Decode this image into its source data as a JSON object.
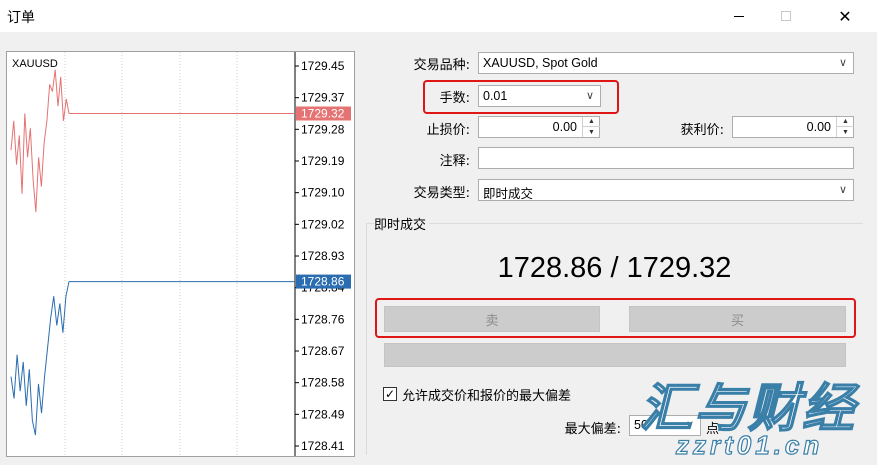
{
  "window": {
    "title": "订单"
  },
  "chart": {
    "symbol": "XAUUSD",
    "price_labels": [
      "1729.45",
      "1729.37",
      "1729.28",
      "1729.19",
      "1729.10",
      "1729.02",
      "1728.93",
      "1728.84",
      "1728.76",
      "1728.67",
      "1728.58",
      "1728.49",
      "1728.41"
    ],
    "ask_label": "1729.32",
    "bid_label": "1728.86",
    "ask_color": "#e57373",
    "bid_color": "#2a6db0",
    "grid_color": "#d0d0d0"
  },
  "chart_data": {
    "type": "line",
    "ylim": [
      1728.41,
      1729.45
    ],
    "series": [
      {
        "name": "",
        "color": "#e57373",
        "values": [
          1729.22,
          1729.3,
          1729.18,
          1729.26,
          1729.1,
          1729.32,
          1729.2,
          1729.28,
          1729.14,
          1729.05,
          1729.2,
          1729.12,
          1729.24,
          1729.3,
          1729.4,
          1729.38,
          1729.44,
          1729.34,
          1729.42,
          1729.3,
          1729.36,
          1729.32
        ]
      },
      {
        "name": "",
        "color": "#2a6db0",
        "values": [
          1728.6,
          1728.54,
          1728.66,
          1728.56,
          1728.64,
          1728.52,
          1728.62,
          1728.48,
          1728.44,
          1728.58,
          1728.5,
          1728.6,
          1728.68,
          1728.76,
          1728.82,
          1728.74,
          1728.8,
          1728.72,
          1728.82,
          1728.86
        ]
      }
    ]
  },
  "form": {
    "symbol_label": "交易品种:",
    "symbol_value": "XAUUSD, Spot Gold",
    "volume_label": "手数:",
    "volume_value": "0.01",
    "sl_label": "止损价:",
    "sl_value": "0.00",
    "tp_label": "获利价:",
    "tp_value": "0.00",
    "comment_label": "注释:",
    "comment_value": "",
    "type_label": "交易类型:",
    "type_value": "即时成交"
  },
  "execution": {
    "group_title": "即时成交",
    "price_display": "1728.86 / 1729.32",
    "sell_label": "卖",
    "buy_label": "买",
    "deviation_check_label": "允许成交价和报价的最大偏差",
    "deviation_checked": true,
    "max_deviation_label": "最大偏差:",
    "max_deviation_value": "50",
    "points_label": "点"
  },
  "watermark": {
    "brand": "汇与财经",
    "url": "zzrt01.cn"
  },
  "colors": {
    "highlight": "#e01515"
  }
}
